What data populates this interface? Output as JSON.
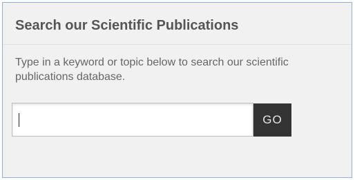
{
  "widget": {
    "title": "Search our Scientific Publications",
    "description": "Type in a keyword or topic below to search our scientific publications database.",
    "search": {
      "value": "",
      "placeholder": ""
    },
    "go_label": "GO"
  },
  "colors": {
    "panel_background": "#f1f1f1",
    "panel_border": "#8eaed8",
    "heading_text": "#555555",
    "body_text": "#666666",
    "button_background": "#343434",
    "button_text": "#e6e6e6"
  }
}
